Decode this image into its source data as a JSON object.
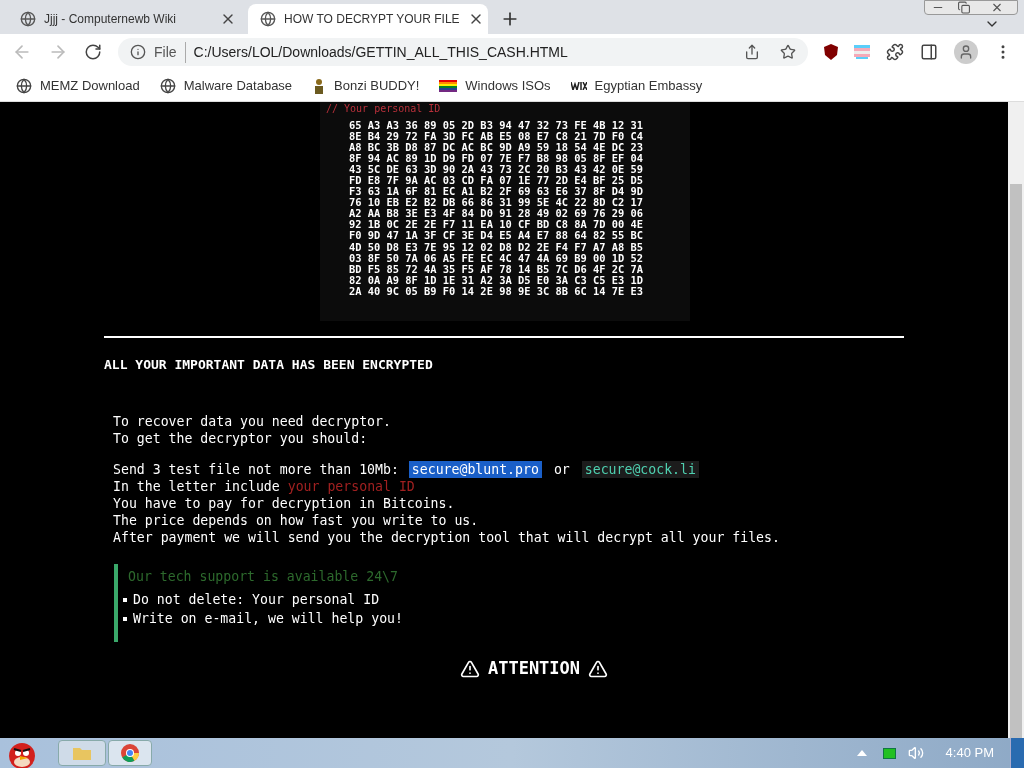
{
  "browser": {
    "tabs": [
      {
        "title": "Jjjj - Computernewb Wiki",
        "selected": false
      },
      {
        "title": "HOW TO DECRYPT YOUR FILE",
        "selected": true
      }
    ],
    "address": {
      "scheme": "File",
      "url": "C:/Users/LOL/Downloads/GETTIN_ALL_THIS_CASH.HTML"
    },
    "bookmarks": [
      {
        "label": "MEMZ Download",
        "kind": "globe"
      },
      {
        "label": "Malware Database",
        "kind": "globe"
      },
      {
        "label": "Bonzi BUDDY!",
        "kind": "figure"
      },
      {
        "label": "Windows ISOs",
        "kind": "flag"
      },
      {
        "label": "Egyptian Embassy",
        "kind": "wix"
      }
    ]
  },
  "page": {
    "id_label": "// Your personal ID",
    "id_rows": [
      "65 A3 A3 36 89 05 2D B3 94 47 32 73 FE 4B 12 31",
      "8E B4 29 72 FA 3D FC AB E5 08 E7 C8 21 7D F0 C4",
      "A8 BC 3B D8 87 DC AC BC 9D A9 59 18 54 4E DC 23",
      "8F 94 AC 89 1D D9 FD 07 7E F7 B8 98 05 8F EF 04",
      "43 5C DE 63 3D 90 2A 43 73 2C 20 B3 43 42 0E 59",
      "FD E8 7F 9A AC 03 CD FA 07 1E 77 2D E4 BF 25 D5",
      "F3 63 1A 6F 81 EC A1 B2 2F 69 63 E6 37 8F D4 9D",
      "76 10 EB E2 B2 DB 66 86 31 99 5E 4C 22 8D C2 17",
      "A2 AA B8 3E E3 4F 84 D0 91 28 49 02 69 76 29 06",
      "92 1B 0C 2E 2E F7 11 EA 10 CF BD C8 8A 7D 00 4E",
      "F0 9D 47 1A 3F CF 3E D4 E5 A4 E7 88 64 82 55 BC",
      "4D 50 D8 E3 7E 95 12 02 D8 D2 2E F4 F7 A7 A8 B5",
      "03 8F 50 7A 06 A5 FE EC 4C 47 4A 69 B9 00 1D 52",
      "BD F5 85 72 4A 35 F5 AF 78 14 B5 7C D6 4F 2C 7A",
      "82 0A A9 8F 1D 1E 31 A2 3A D5 E0 3A C3 C5 E3 1D",
      "2A 40 9C 05 B9 F0 14 2E 98 9E 3C 8B 6C 14 7E E3"
    ],
    "heading": "ALL YOUR IMPORTANT DATA HAS BEEN ENCRYPTED",
    "intro": [
      "To recover data you need decryptor.",
      "To get the decryptor you should:"
    ],
    "send_text": "Send 3 test file not more than 10Mb:",
    "emails": [
      {
        "text": "secure@blunt.pro",
        "selected": true
      },
      {
        "text": "secure@cock.li",
        "selected": false
      }
    ],
    "or": "or",
    "include_text": "In the letter include",
    "include_highlight": "your personal ID",
    "lines": [
      "You have to pay for decryption in Bitcoins.",
      "The price depends on how fast you write to us.",
      "After payment we will send you the decryption tool that will decrypt all your files."
    ],
    "support": {
      "title": "Our tech support is available 24\\7",
      "items": [
        "Do not delete: Your personal ID",
        "Write on e-mail, we will help you!"
      ]
    },
    "attention": "ATTENTION"
  },
  "taskbar": {
    "clock": "4:40 PM"
  }
}
